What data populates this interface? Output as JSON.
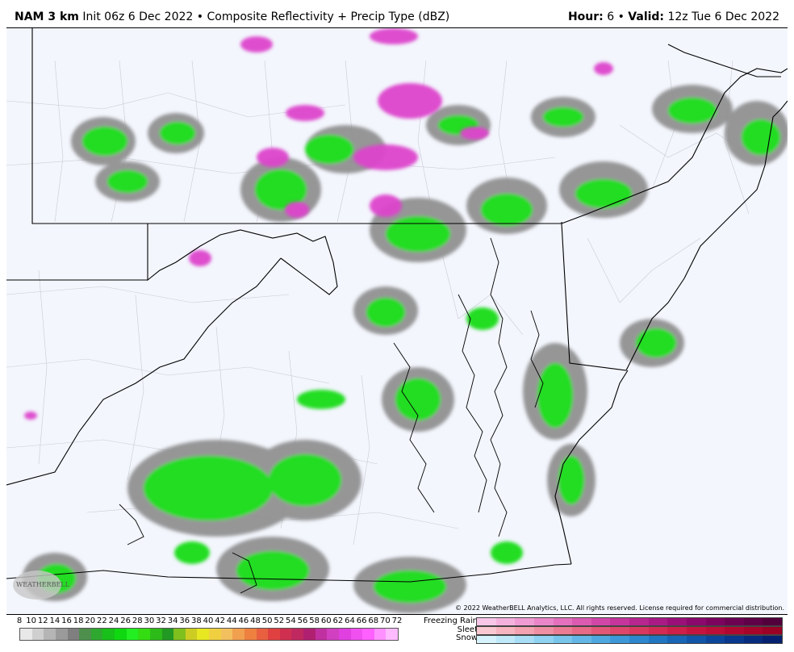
{
  "header": {
    "model": "NAM 3 km",
    "init": "Init 06z 6 Dec 2022",
    "separator": "•",
    "product": "Composite Reflectivity + Precip Type (dBZ)",
    "hour_label": "Hour:",
    "hour_value": "6",
    "valid_label": "Valid:",
    "valid_value": "12z Tue 6 Dec 2022"
  },
  "map": {
    "copyright": "© 2022 WeatherBELL Analytics, LLC. All rights reserved. License required for commercial distribution.",
    "logo_text": "WEATHERBELL",
    "background_color": "#f3f6fd",
    "rain_color": "#22dd22",
    "mix_color": "#dd44cc"
  },
  "legend": {
    "dbz_ticks": [
      "8",
      "10",
      "12",
      "14",
      "16",
      "18",
      "20",
      "22",
      "24",
      "26",
      "28",
      "30",
      "32",
      "34",
      "36",
      "38",
      "40",
      "42",
      "44",
      "46",
      "48",
      "50",
      "52",
      "54",
      "56",
      "58",
      "60",
      "62",
      "64",
      "66",
      "68",
      "70",
      "72"
    ],
    "dbz_colors": [
      "#e8e8e8",
      "#cfcfcf",
      "#b5b5b5",
      "#9a9a9a",
      "#7f7f7f",
      "#4e8f4e",
      "#2fa82f",
      "#19c019",
      "#10d810",
      "#22ee22",
      "#33dd11",
      "#2cbb18",
      "#229922",
      "#7fbf1e",
      "#cccc22",
      "#e7e722",
      "#f0d040",
      "#f3c060",
      "#f1a050",
      "#ee8040",
      "#e86040",
      "#e04040",
      "#d03050",
      "#c02860",
      "#b02070",
      "#c030a0",
      "#d040c0",
      "#e040e0",
      "#f050f0",
      "#ff60ff",
      "#ff90ff",
      "#ffbbff"
    ],
    "freezing_rain_label": "Freezing Rain",
    "sleet_label": "Sleet",
    "snow_label": "Snow",
    "freezing_rain_colors": [
      "#f7c6e8",
      "#f4b1de",
      "#f09cd4",
      "#ea86c9",
      "#e470be",
      "#db5ab2",
      "#d147a7",
      "#c5359c",
      "#b82690",
      "#a91a84",
      "#9a1078",
      "#8b086c",
      "#7c045f",
      "#6d0253",
      "#5f0147",
      "#52003c"
    ],
    "sleet_colors": [
      "#f9c8d0",
      "#f6b5c1",
      "#f3a2b2",
      "#ef8fa3",
      "#eb7c94",
      "#e76a86",
      "#e35878",
      "#de476b",
      "#d9385f",
      "#d32b54",
      "#cc1f4a",
      "#c41541",
      "#bb0e39",
      "#b10832",
      "#a6042b",
      "#9b0125"
    ],
    "snow_colors": [
      "#d6f3fb",
      "#bfe9f8",
      "#a7def5",
      "#8fd2f1",
      "#78c5ec",
      "#62b7e6",
      "#4ea8df",
      "#3c98d7",
      "#2d87cd",
      "#2176c2",
      "#1865b6",
      "#1155a9",
      "#0c469b",
      "#09388c",
      "#072b7d",
      "#05206e"
    ]
  }
}
